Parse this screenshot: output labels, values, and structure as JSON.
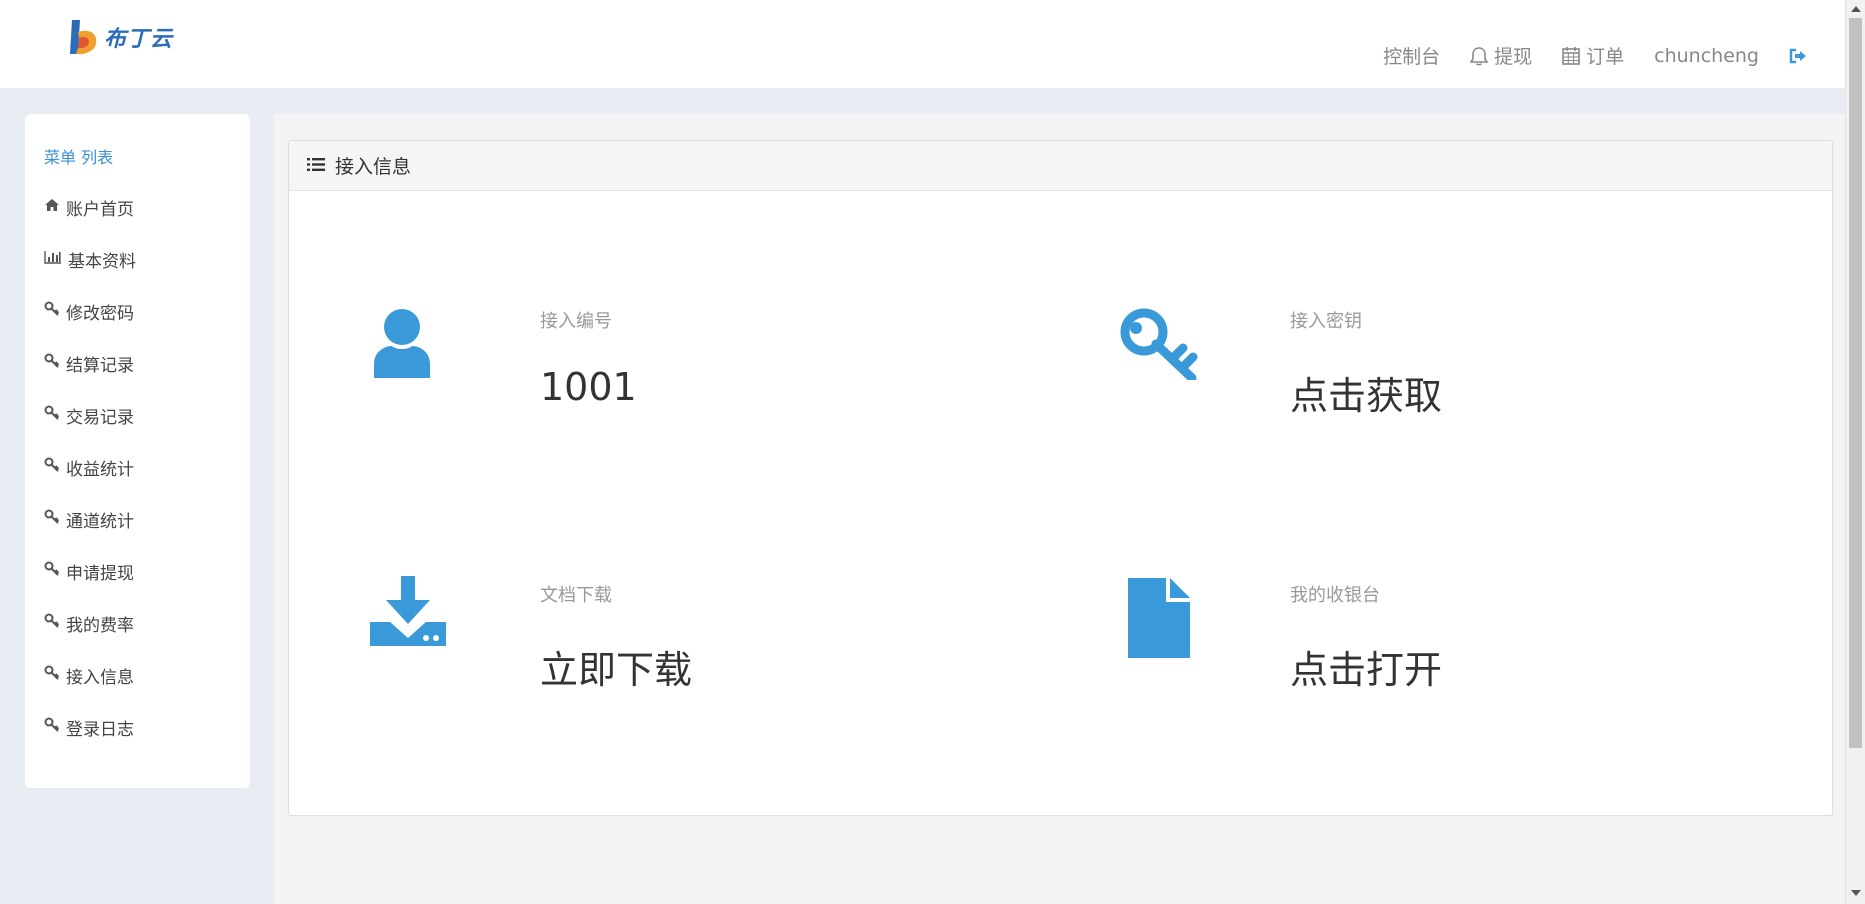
{
  "header": {
    "logo_text": "布丁云",
    "nav": {
      "console": "控制台",
      "withdraw": "提现",
      "orders": "订单",
      "username": "chuncheng"
    }
  },
  "sidebar": {
    "title": "菜单 列表",
    "items": [
      {
        "label": "账户首页",
        "icon": "home-icon"
      },
      {
        "label": "基本资料",
        "icon": "bar-chart-icon"
      },
      {
        "label": "修改密码",
        "icon": "key-icon"
      },
      {
        "label": "结算记录",
        "icon": "key-icon"
      },
      {
        "label": "交易记录",
        "icon": "key-icon"
      },
      {
        "label": "收益统计",
        "icon": "key-icon"
      },
      {
        "label": "通道统计",
        "icon": "key-icon"
      },
      {
        "label": "申请提现",
        "icon": "key-icon"
      },
      {
        "label": "我的费率",
        "icon": "key-icon"
      },
      {
        "label": "接入信息",
        "icon": "key-icon"
      },
      {
        "label": "登录日志",
        "icon": "key-icon"
      }
    ]
  },
  "panel": {
    "title": "接入信息",
    "cards": {
      "merchant_id": {
        "label": "接入编号",
        "value": "1001",
        "icon": "user-icon"
      },
      "secret_key": {
        "label": "接入密钥",
        "value": "点击获取",
        "icon": "key-icon"
      },
      "docs": {
        "label": "文档下载",
        "value": "立即下载",
        "icon": "download-icon"
      },
      "cashier": {
        "label": "我的收银台",
        "value": "点击打开",
        "icon": "file-icon"
      }
    }
  },
  "colors": {
    "accent": "#3a9ad9",
    "sidebar_title": "#3a8fd8",
    "logo": "#2b6cb8",
    "background": "#e8ecf3"
  }
}
